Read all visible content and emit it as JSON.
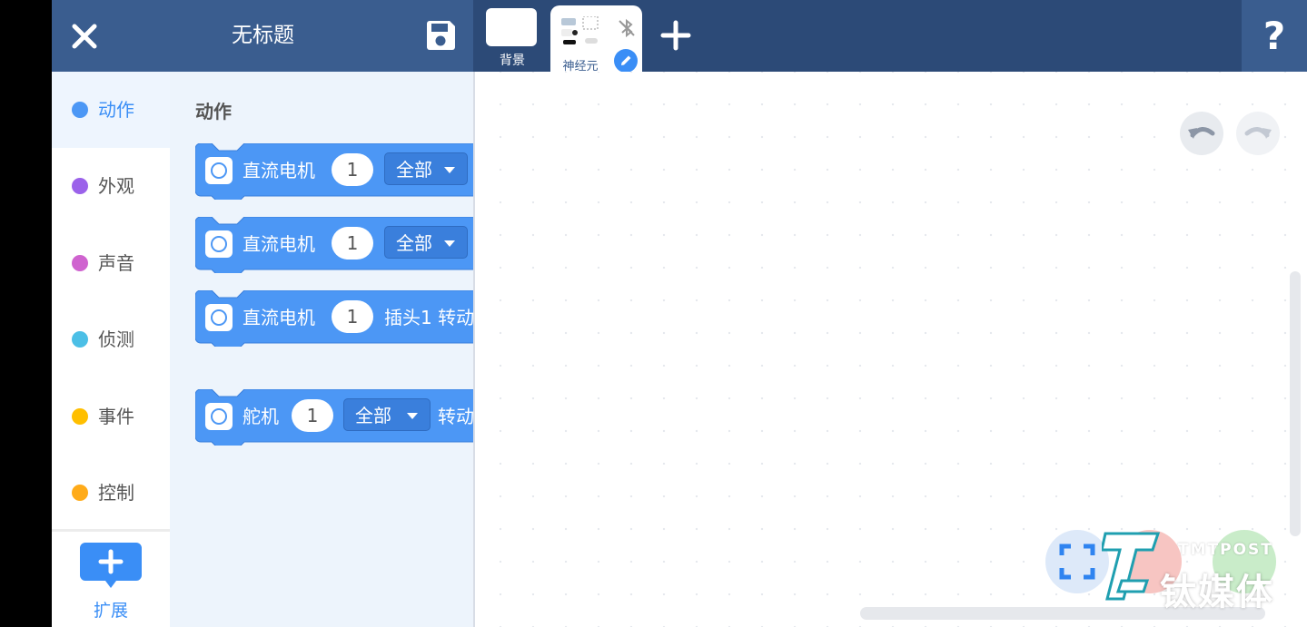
{
  "header": {
    "title": "无标题",
    "sprites": [
      {
        "label": "背景"
      },
      {
        "label": "神经元"
      }
    ],
    "help_label": "?"
  },
  "nav": {
    "items": [
      {
        "label": "动作",
        "color": "#4c97f5"
      },
      {
        "label": "外观",
        "color": "#9b62ea"
      },
      {
        "label": "声音",
        "color": "#cf63cf"
      },
      {
        "label": "侦测",
        "color": "#4cbfe6"
      },
      {
        "label": "事件",
        "color": "#ffbf00"
      },
      {
        "label": "控制",
        "color": "#ffab19"
      }
    ],
    "extension_label": "扩展"
  },
  "palette": {
    "category_title": "动作",
    "blocks": [
      {
        "text": "直流电机",
        "number": "1",
        "dropdown": "全部"
      },
      {
        "text": "直流电机",
        "number": "1",
        "dropdown": "全部"
      },
      {
        "text": "直流电机",
        "number": "1",
        "suffix": "插头1 转动"
      },
      {
        "text": "舵机",
        "number": "1",
        "dropdown": "全部",
        "suffix": "转动"
      }
    ]
  },
  "watermark": {
    "en": "TMTPOST",
    "cn": "钛媒体"
  },
  "colors": {
    "header": "#2c4a77",
    "header_left": "#3a5d8f",
    "block": "#4c97f5",
    "accent": "#3a8ef6"
  }
}
